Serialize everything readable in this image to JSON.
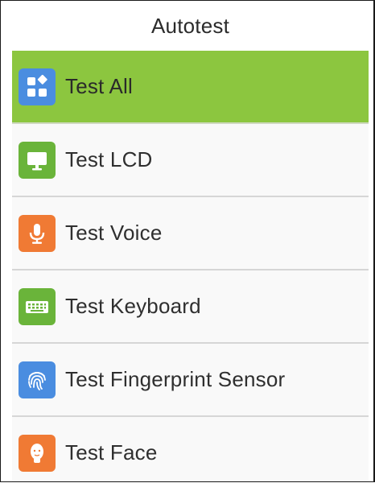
{
  "header": {
    "title": "Autotest"
  },
  "colors": {
    "selected_row": "#8cc63f",
    "icon_blue": "#4a8de0",
    "icon_green": "#6ab43a",
    "icon_orange": "#f07a34"
  },
  "menu": {
    "items": [
      {
        "label": "Test All",
        "icon": "grid-icon",
        "selected": true
      },
      {
        "label": "Test LCD",
        "icon": "monitor-icon",
        "selected": false
      },
      {
        "label": "Test Voice",
        "icon": "microphone-icon",
        "selected": false
      },
      {
        "label": "Test Keyboard",
        "icon": "keyboard-icon",
        "selected": false
      },
      {
        "label": "Test Fingerprint Sensor",
        "icon": "fingerprint-icon",
        "selected": false
      },
      {
        "label": "Test Face",
        "icon": "face-icon",
        "selected": false
      }
    ]
  }
}
